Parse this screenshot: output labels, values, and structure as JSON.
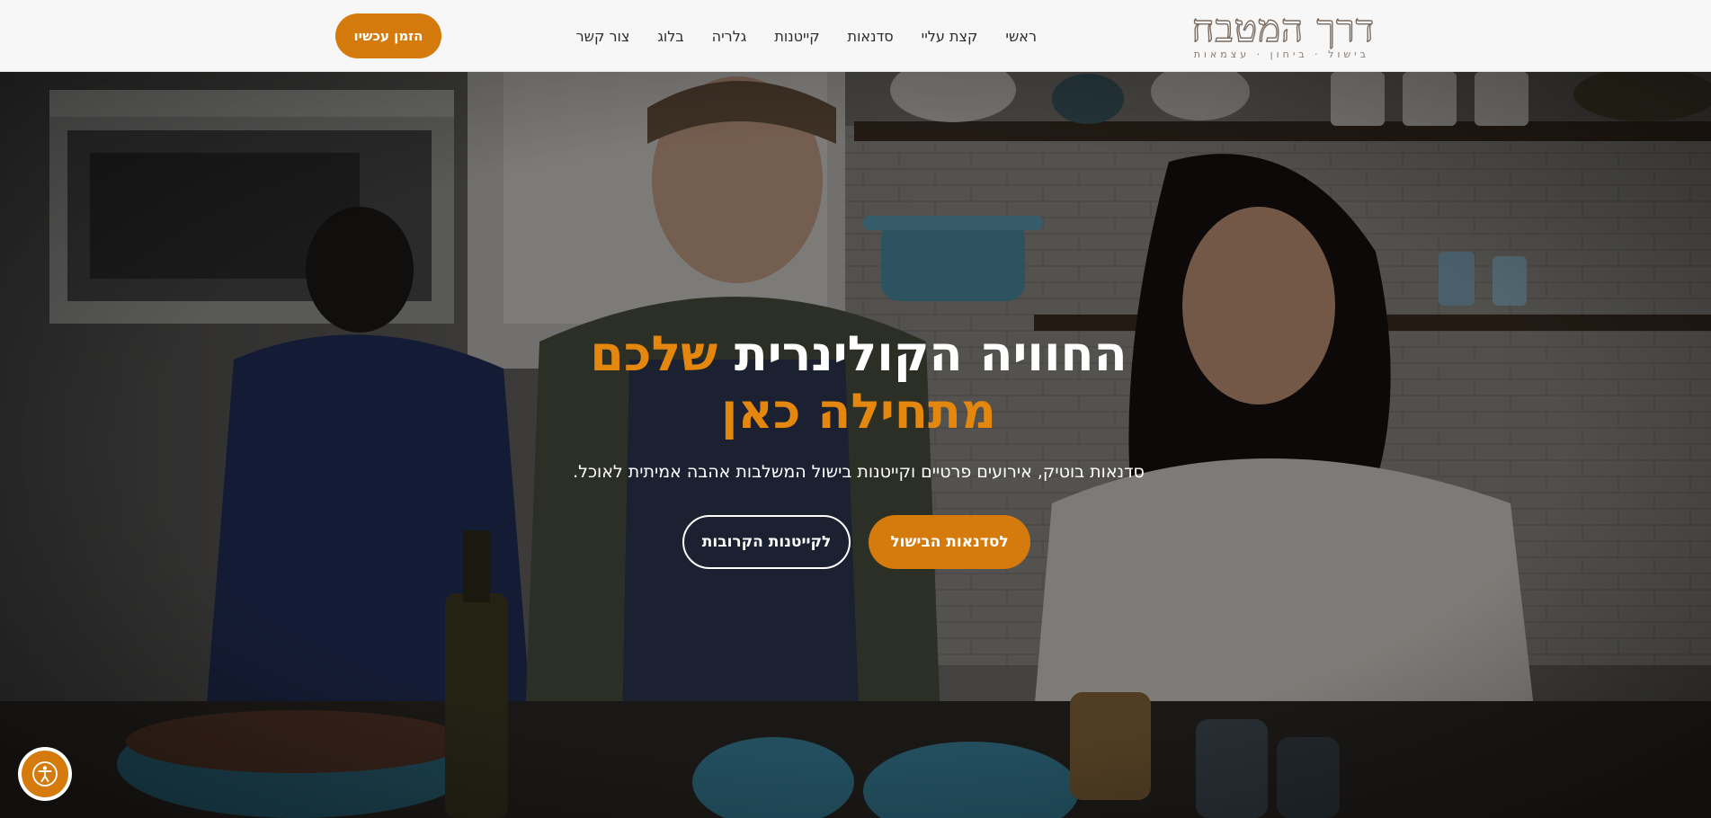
{
  "brand": {
    "name": "דרך המטבח",
    "tagline": "בישול · ביחון · עצמאות",
    "accent_color": "#d57a0c"
  },
  "nav": {
    "items": [
      {
        "label": "ראשי"
      },
      {
        "label": "קצת עליי"
      },
      {
        "label": "סדנאות"
      },
      {
        "label": "קייטנות"
      },
      {
        "label": "גלריה"
      },
      {
        "label": "בלוג"
      },
      {
        "label": "צור קשר"
      }
    ],
    "cta_label": "הזמן עכשיו"
  },
  "hero": {
    "title_white": "החוויה הקולינרית",
    "title_accent": "שלכם מתחילה כאן",
    "subtitle": "סדנאות בוטיק, אירועים פרטיים וקייטנות בישול המשלבות אהבה אמיתית לאוכל.",
    "primary_button": "לסדנאות הבישול",
    "secondary_button": "לקייטנות הקרובות"
  },
  "accessibility": {
    "icon": "accessibility-icon"
  }
}
